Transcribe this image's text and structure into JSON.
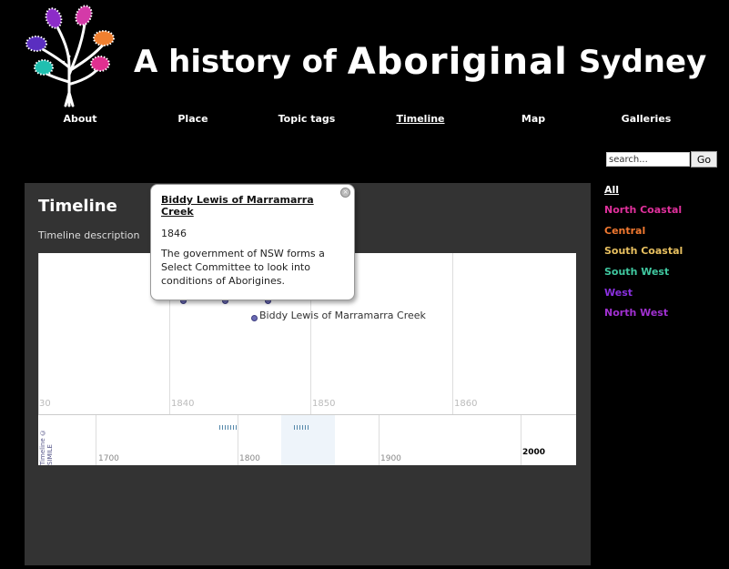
{
  "header": {
    "title_part1": "A  history of",
    "title_part2": "Aboriginal",
    "title_part3": "Sydney"
  },
  "nav": [
    {
      "label": "About"
    },
    {
      "label": "Place"
    },
    {
      "label": "Topic tags"
    },
    {
      "label": "Timeline",
      "active": true
    },
    {
      "label": "Map"
    },
    {
      "label": "Galleries"
    }
  ],
  "search": {
    "value": "search...",
    "go_label": "Go"
  },
  "filters": [
    {
      "label": "All",
      "color": "#ffffff"
    },
    {
      "label": "North Coastal",
      "color": "#e0309c"
    },
    {
      "label": "Central",
      "color": "#f07830"
    },
    {
      "label": "South Coastal",
      "color": "#e8c060"
    },
    {
      "label": "South West",
      "color": "#40c8a0"
    },
    {
      "label": "West",
      "color": "#8a30e0"
    },
    {
      "label": "North West",
      "color": "#a030d0"
    }
  ],
  "main": {
    "title": "Timeline",
    "description": "Timeline description"
  },
  "timeline": {
    "upper_labels": [
      "30",
      "1840",
      "1850",
      "1860"
    ],
    "lower_labels": [
      "1700",
      "1800",
      "1900",
      "2000"
    ],
    "event_label": "Biddy Lewis of Marramarra Creek",
    "credit": "Timeline © SIMILE"
  },
  "popup": {
    "title": "Biddy Lewis of Marramarra Creek",
    "year": "1846",
    "text": "The government of NSW forms a Select Committee to look into conditions of Aborigines."
  },
  "colors": {
    "background": "#000000",
    "panel": "#333333",
    "event_dot": "#6b6bb4"
  }
}
